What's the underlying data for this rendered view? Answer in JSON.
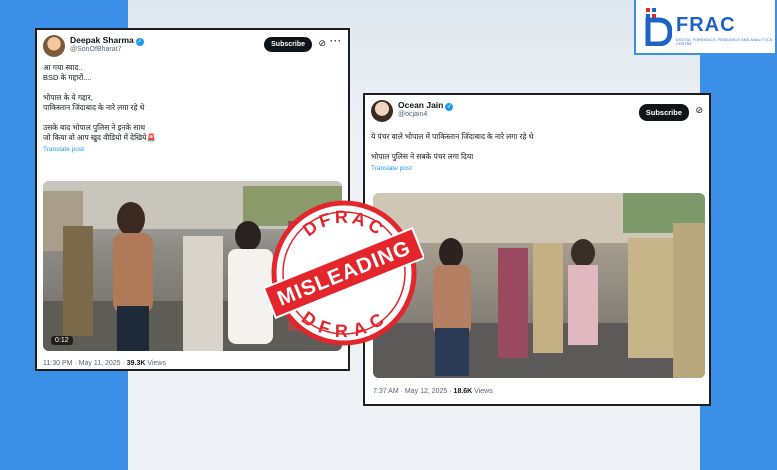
{
  "left_tweet": {
    "display_name": "Deepak Sharma",
    "handle": "@SonOfBharat7",
    "subscribe_label": "Subscribe",
    "more_label": "···",
    "lines": [
      "आ गया स्वाद..",
      "BSD के गद्दारों....",
      "",
      "भोपाल के ये गद्दार,",
      "पाकिस्तान जिंदाबाद के नारे लगा रहे थे",
      "",
      "उसके बाद भोपाल पुलिस ने इनके साथ",
      "जो किया वो आप खुद वीडियो में देखिये🚨"
    ],
    "translate_label": "Translate post",
    "video_duration": "0:12",
    "timestamp": "11:30 PM · May 11, 2025 · ",
    "views_count": "39.3K",
    "views_label": " Views"
  },
  "right_tweet": {
    "display_name": "Ocean Jain",
    "handle": "@ocjain4",
    "subscribe_label": "Subscribe",
    "lines": [
      "ये पंचर वाले भोपाल में पाकिस्तान जिंदाबाद के नारे लगा रहे थे",
      "",
      "भोपाल पुलिस ने सबके पंचर लगा दिया"
    ],
    "translate_label": "Translate post",
    "timestamp": "7:37 AM · May 12, 2025 · ",
    "views_count": "18.6K",
    "views_label": " Views"
  },
  "stamp": {
    "top_text": "DFRAC",
    "bottom_text": "DFRAC",
    "label": "MISLEADING",
    "color": "#e3262c"
  },
  "logo": {
    "text": "FRAC",
    "tagline": "DIGITAL FORENSICS, RESEARCH AND ANALYTICS CENTRE",
    "color": "#1d63c4"
  }
}
